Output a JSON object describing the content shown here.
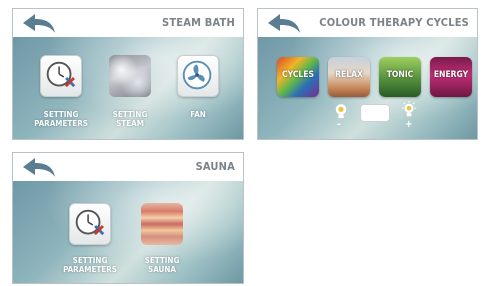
{
  "steam_bath": {
    "title": "STEAM BATH",
    "items": [
      {
        "line1": "SETTING",
        "line2": "PARAMETERS"
      },
      {
        "line1": "SETTING",
        "line2": "STEAM"
      },
      {
        "line1": "FAN",
        "line2": ""
      }
    ]
  },
  "colour_therapy": {
    "title": "COLOUR THERAPY CYCLES",
    "tiles": [
      "CYCLES",
      "RELAX",
      "TONIC",
      "ENERGY"
    ],
    "minus": "-",
    "plus": "+"
  },
  "sauna": {
    "title": "SAUNA",
    "items": [
      {
        "line1": "SETTING",
        "line2": "PARAMETERS"
      },
      {
        "line1": "SETTING",
        "line2": "SAUNA"
      }
    ]
  },
  "icons": [
    "back-arrow-icon",
    "clock-tools-icon",
    "steam-icon",
    "fan-icon",
    "sauna-icon",
    "bulb-dim-icon",
    "bulb-bright-icon"
  ],
  "colors": {
    "title_text": "#7b8388",
    "back_arrow": "#5b7d93",
    "label_text": "#ffffff"
  }
}
